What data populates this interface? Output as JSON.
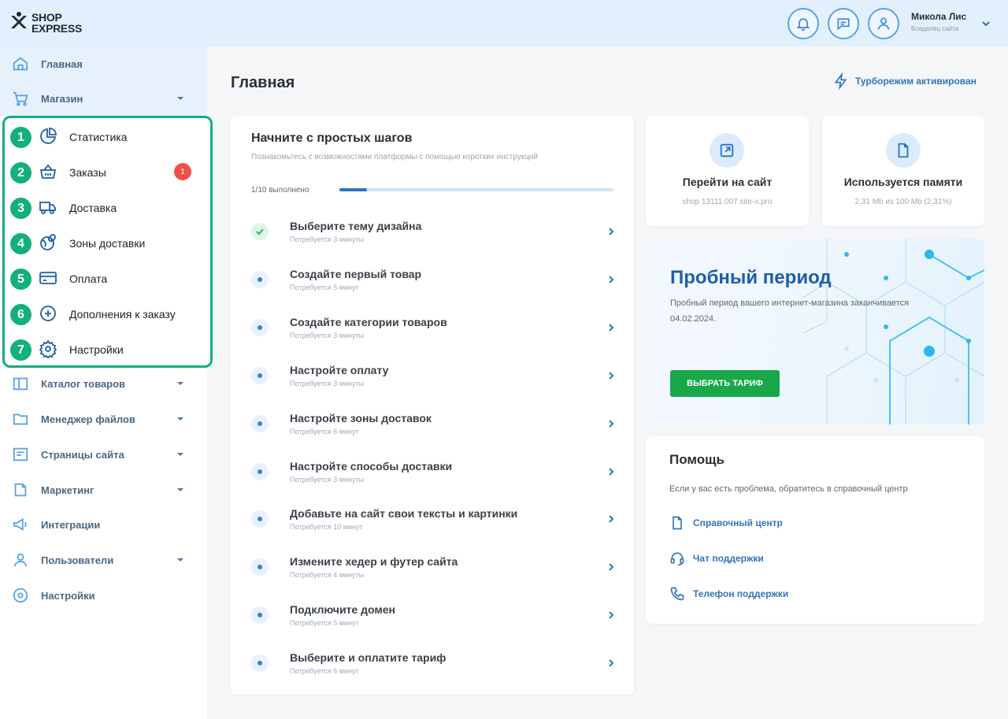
{
  "header": {
    "logo_line1": "SHOP",
    "logo_line2": "EXPRESS",
    "user_name": "Микола Лис",
    "user_role": "Владелец сайта",
    "icons": [
      "bell-icon",
      "chat-icon",
      "user-icon"
    ]
  },
  "sidebar": {
    "main": {
      "label": "Главная",
      "icon": "home-icon"
    },
    "shop": {
      "label": "Магазин",
      "icon": "cart-icon"
    },
    "shop_sub": [
      {
        "num": "1",
        "label": "Статистика",
        "icon": "pie-chart-icon"
      },
      {
        "num": "2",
        "label": "Заказы",
        "icon": "basket-icon",
        "badge": "1"
      },
      {
        "num": "3",
        "label": "Доставка",
        "icon": "truck-icon"
      },
      {
        "num": "4",
        "label": "Зоны доставки",
        "icon": "globe-pin-icon"
      },
      {
        "num": "5",
        "label": "Оплата",
        "icon": "card-icon"
      },
      {
        "num": "6",
        "label": "Дополнения к заказу",
        "icon": "plus-circle-icon"
      },
      {
        "num": "7",
        "label": "Настройки",
        "icon": "gear-icon"
      }
    ],
    "items": [
      {
        "label": "Каталог товаров",
        "icon": "book-icon",
        "expandable": true
      },
      {
        "label": "Менеджер файлов",
        "icon": "folder-icon",
        "expandable": true
      },
      {
        "label": "Страницы сайта",
        "icon": "pages-icon",
        "expandable": true
      },
      {
        "label": "Маркетинг",
        "icon": "marketing-icon",
        "expandable": true
      },
      {
        "label": "Интеграции",
        "icon": "megaphone-icon",
        "expandable": false
      },
      {
        "label": "Пользователи",
        "icon": "users-icon",
        "expandable": true
      },
      {
        "label": "Настройки",
        "icon": "gear-icon",
        "expandable": false
      }
    ]
  },
  "main": {
    "title": "Главная",
    "turbo": "Турборежим активирован",
    "steps": {
      "title": "Начните с простых шагов",
      "subtitle": "Познакомьтесь с возможностями платформы с помощью коротких инструкций",
      "progress_label": "1/10 выполнено",
      "progress_fraction": 0.1,
      "items": [
        {
          "name": "Выберите тему дизайна",
          "time": "Потребуется 3 минуты",
          "done": true
        },
        {
          "name": "Создайте первый товар",
          "time": "Потребуется 5 минут",
          "done": false
        },
        {
          "name": "Создайте категории товаров",
          "time": "Потребуется 3 минуты",
          "done": false
        },
        {
          "name": "Настройте оплату",
          "time": "Потребуется 3 минуты",
          "done": false
        },
        {
          "name": "Настройте зоны доставок",
          "time": "Потребуется 6 минут",
          "done": false
        },
        {
          "name": "Настройте способы доставки",
          "time": "Потребуется 3 минуты",
          "done": false
        },
        {
          "name": "Добавьте на сайт свои тексты и картинки",
          "time": "Потребуется 10 минут",
          "done": false
        },
        {
          "name": "Измените хедер и футер сайта",
          "time": "Потребуется 4 минуты",
          "done": false
        },
        {
          "name": "Подключите домен",
          "time": "Потребуется 5 минут",
          "done": false
        },
        {
          "name": "Выберите и оплатите тариф",
          "time": "Потребуется 6 минут",
          "done": false
        }
      ]
    },
    "site_card": {
      "title": "Перейти на сайт",
      "sub": "shop 13111.007.site-x.pro"
    },
    "memory_card": {
      "title": "Используется памяти",
      "sub": "2,31 Mb из 100 Mb (2,31%)"
    },
    "trial": {
      "title": "Пробный период",
      "text": "Пробный период вашего интернет-магазина заканчивается 04.02.2024.",
      "button": "ВЫБРАТЬ ТАРИФ"
    },
    "help": {
      "title": "Помощь",
      "text": "Если у вас есть проблема, обратитесь в справочный центр",
      "links": [
        {
          "label": "Справочный центр",
          "icon": "document-icon"
        },
        {
          "label": "Чат поддержки",
          "icon": "headset-icon"
        },
        {
          "label": "Телефон поддержки",
          "icon": "phone-icon"
        }
      ]
    }
  },
  "colors": {
    "accent": "#3474b8",
    "highlight": "#12b07b",
    "badge": "#f2504b",
    "cta": "#18a84a",
    "header_bg": "#e2f0fd"
  }
}
